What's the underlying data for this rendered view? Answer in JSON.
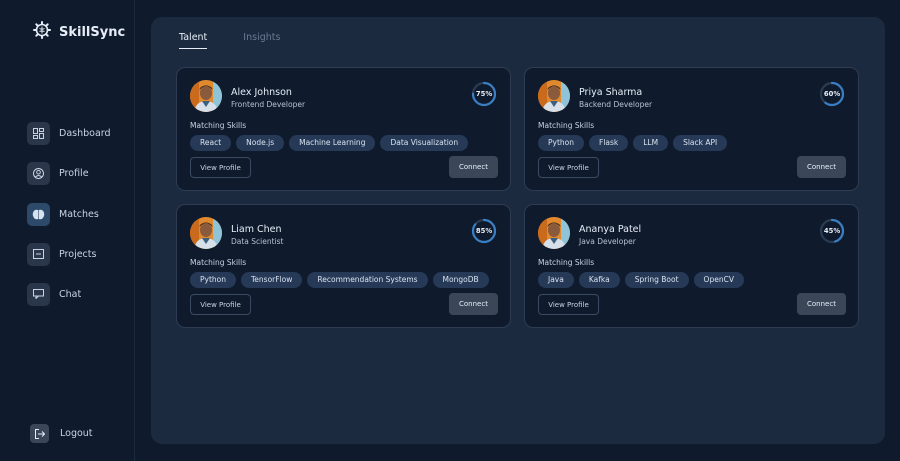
{
  "brand": {
    "name": "SkillSync",
    "logo_icon": "gear-brain-icon"
  },
  "sidebar": {
    "items": [
      {
        "label": "Dashboard",
        "icon": "dashboard-icon"
      },
      {
        "label": "Profile",
        "icon": "profile-icon"
      },
      {
        "label": "Matches",
        "icon": "brain-icon",
        "active": true
      },
      {
        "label": "Projects",
        "icon": "projects-icon"
      },
      {
        "label": "Chat",
        "icon": "chat-icon"
      }
    ],
    "logout": "Logout"
  },
  "tabs": [
    {
      "label": "Talent",
      "active": true
    },
    {
      "label": "Insights",
      "active": false
    }
  ],
  "cards": [
    {
      "name": "Alex Johnson",
      "role": "Frontend Developer",
      "match": "75%",
      "match_value": 75,
      "skills_title": "Matching Skills",
      "skills": [
        "React",
        "Node.js",
        "Machine Learning",
        "Data Visualization"
      ],
      "view_label": "View Profile",
      "connect_label": "Connect"
    },
    {
      "name": "Priya Sharma",
      "role": "Backend Developer",
      "match": "60%",
      "match_value": 60,
      "skills_title": "Matching Skills",
      "skills": [
        "Python",
        "Flask",
        "LLM",
        "Slack API"
      ],
      "view_label": "View Profile",
      "connect_label": "Connect"
    },
    {
      "name": "Liam Chen",
      "role": "Data Scientist",
      "match": "85%",
      "match_value": 85,
      "skills_title": "Matching Skills",
      "skills": [
        "Python",
        "TensorFlow",
        "Recommendation Systems",
        "MongoDB"
      ],
      "view_label": "View Profile",
      "connect_label": "Connect"
    },
    {
      "name": "Ananya Patel",
      "role": "Java Developer",
      "match": "45%",
      "match_value": 45,
      "skills_title": "Matching Skills",
      "skills": [
        "Java",
        "Kafka",
        "Spring Boot",
        "OpenCV"
      ],
      "view_label": "View Profile",
      "connect_label": "Connect"
    }
  ],
  "colors": {
    "accent": "#3a7fc4",
    "ring_track": "#2a3b52",
    "chip_bg": "#263a57"
  }
}
